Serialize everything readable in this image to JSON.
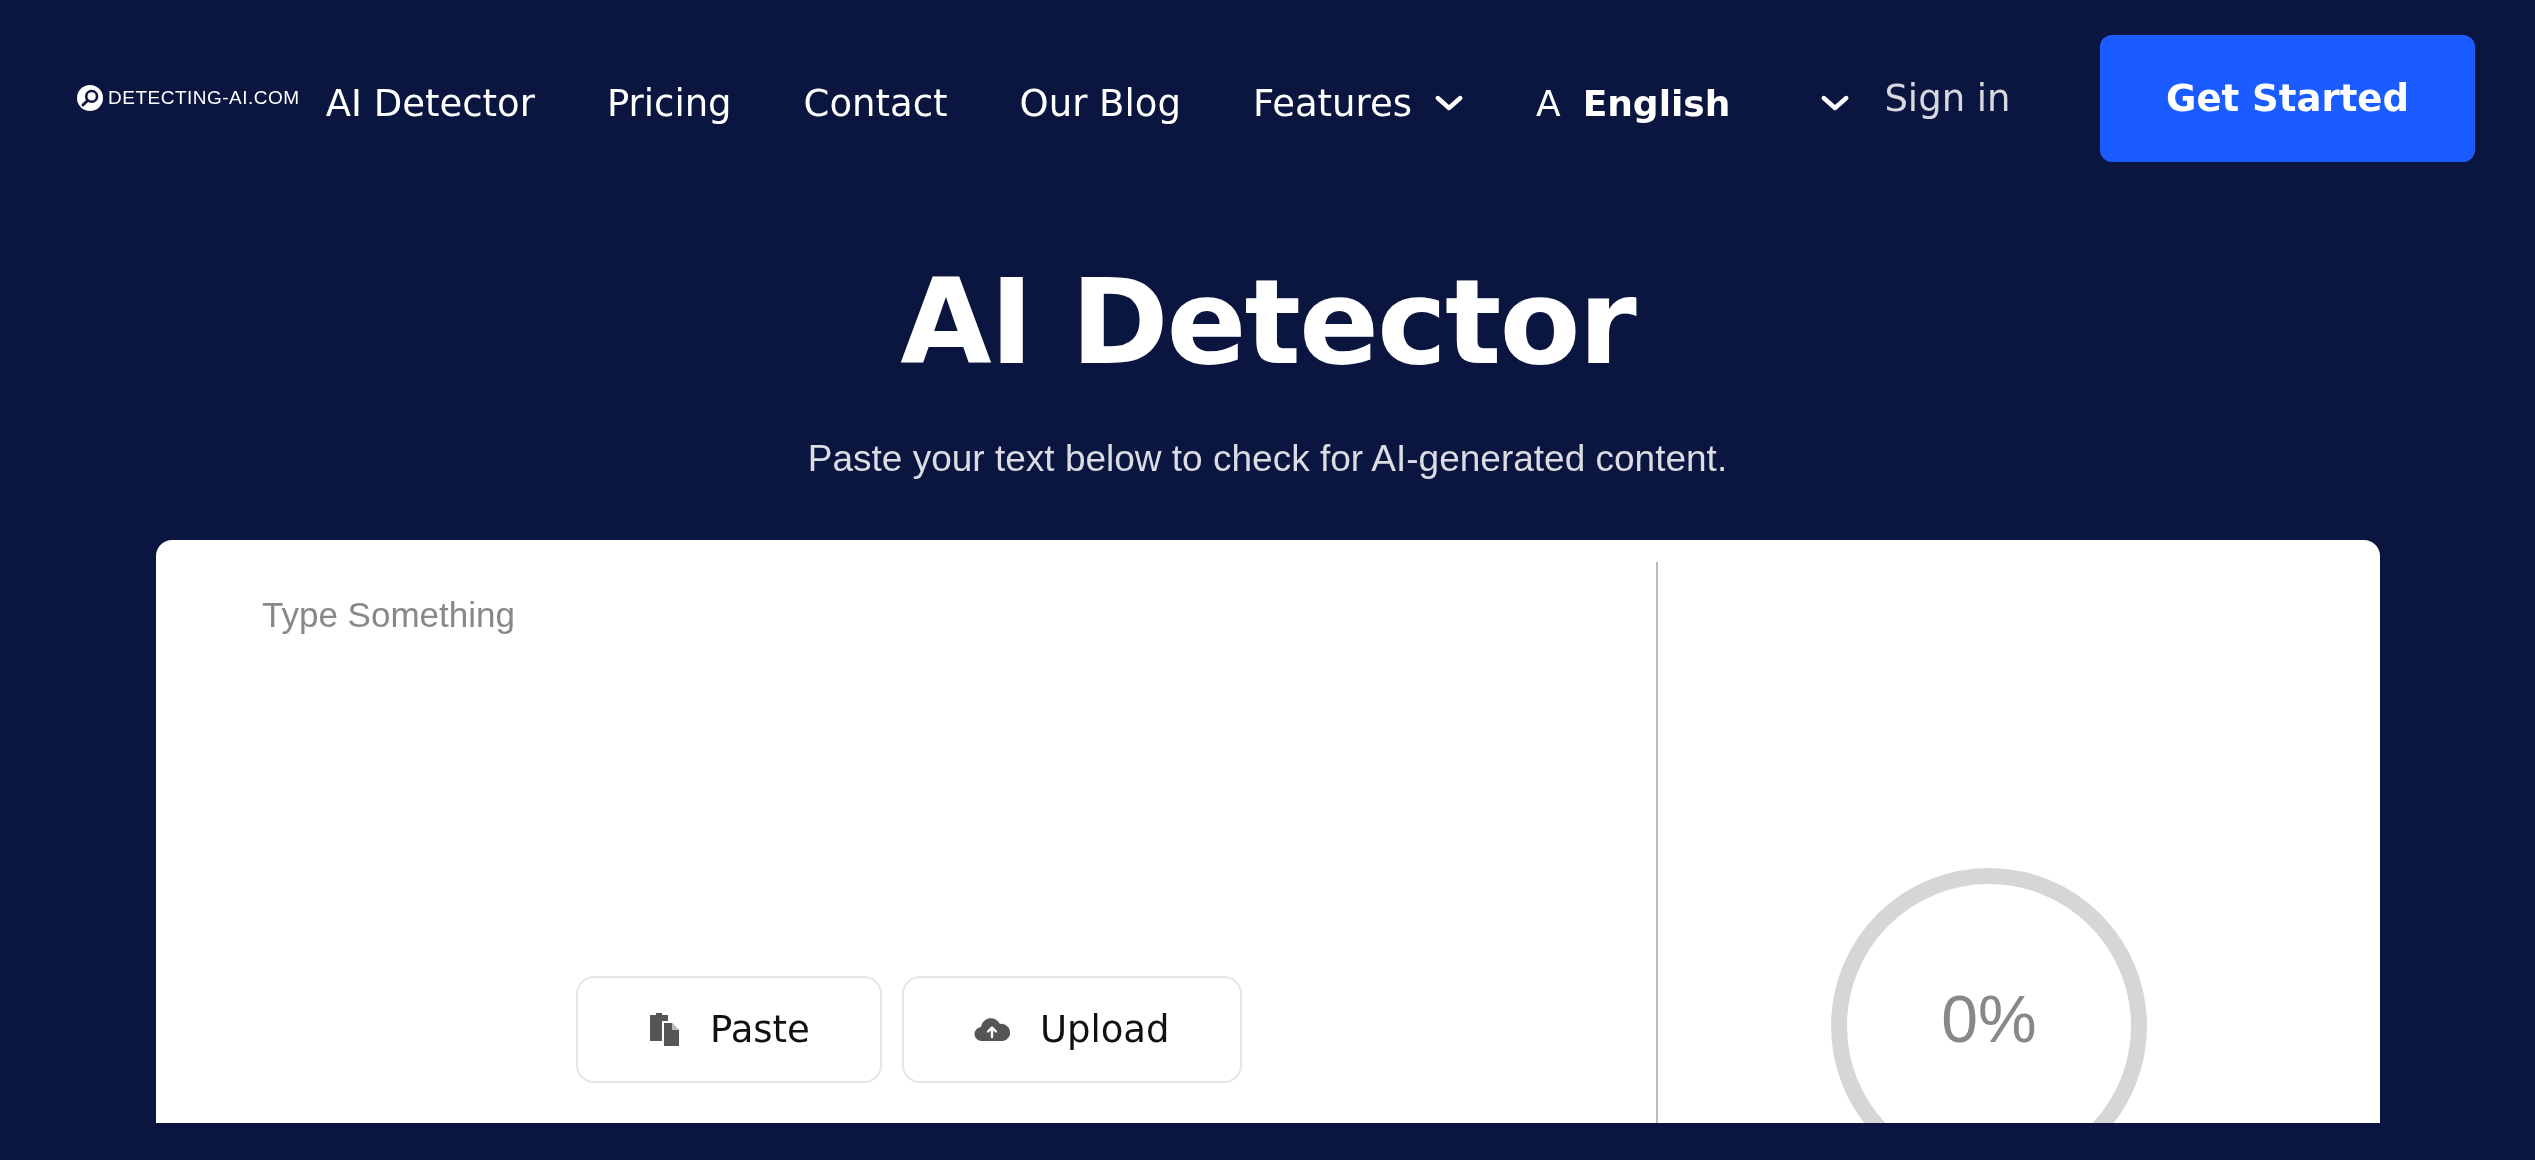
{
  "header": {
    "logo": "DETECTING-AI.COM",
    "nav": [
      {
        "label": "AI Detector",
        "dropdown": false
      },
      {
        "label": "Pricing",
        "dropdown": false
      },
      {
        "label": "Contact",
        "dropdown": false
      },
      {
        "label": "Our Blog",
        "dropdown": false
      },
      {
        "label": "Features",
        "dropdown": true
      }
    ],
    "language": {
      "icon": "A",
      "value": "English"
    },
    "sign_in": "Sign in",
    "cta": "Get Started"
  },
  "hero": {
    "title": "AI Detector",
    "subtitle": "Paste your text below to check for AI-generated content."
  },
  "editor": {
    "placeholder": "Type Something",
    "buttons": [
      {
        "kind": "paste",
        "label": "Paste"
      },
      {
        "kind": "upload",
        "label": "Upload"
      }
    ]
  },
  "result": {
    "score": "0%"
  }
}
